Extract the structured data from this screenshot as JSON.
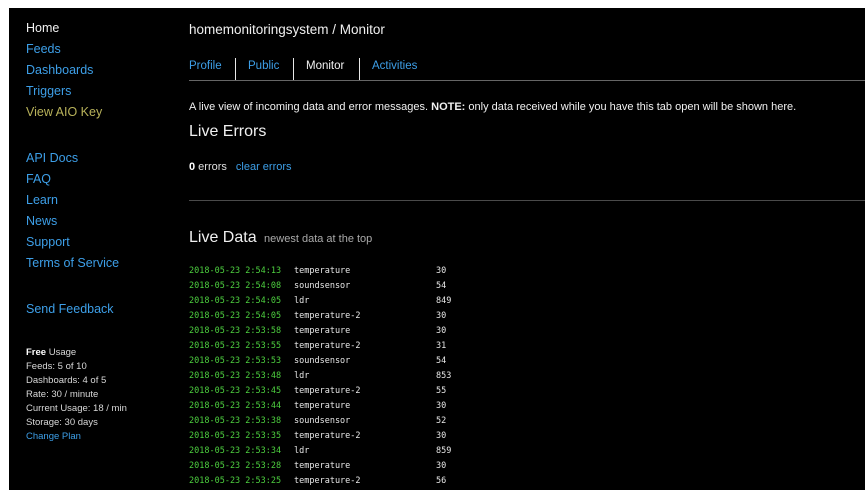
{
  "sidebar": {
    "nav_primary": [
      "Home",
      "Feeds",
      "Dashboards",
      "Triggers",
      "View AIO Key"
    ],
    "nav_secondary": [
      "API Docs",
      "FAQ",
      "Learn",
      "News",
      "Support",
      "Terms of Service"
    ],
    "send_feedback": "Send Feedback",
    "usage": {
      "title_bold": "Free",
      "title_rest": " Usage",
      "feeds": "Feeds: 5 of 10",
      "dashboards": "Dashboards: 4 of 5",
      "rate": "Rate: 30 / minute",
      "current": "Current Usage: 18 / min",
      "storage": "Storage: 30 days",
      "change_plan": "Change Plan"
    }
  },
  "header": {
    "breadcrumb": "homemonitoringsystem / Monitor"
  },
  "tabs": [
    "Profile",
    "Public",
    "Monitor",
    "Activities"
  ],
  "active_tab": "Monitor",
  "description": {
    "text": "A live view of incoming data and error messages. ",
    "note_label": "NOTE:",
    "note_text": " only data received while you have this tab open will be shown here."
  },
  "live_errors": {
    "heading": "Live Errors",
    "count": "0",
    "count_suffix": " errors",
    "clear_label": "clear errors"
  },
  "live_data": {
    "heading": "Live Data",
    "subheading": "newest data at the top",
    "rows": [
      {
        "timestamp": "2018-05-23 2:54:13",
        "feed": "temperature",
        "value": "30"
      },
      {
        "timestamp": "2018-05-23 2:54:08",
        "feed": "soundsensor",
        "value": "54"
      },
      {
        "timestamp": "2018-05-23 2:54:05",
        "feed": "ldr",
        "value": "849"
      },
      {
        "timestamp": "2018-05-23 2:54:05",
        "feed": "temperature-2",
        "value": "30"
      },
      {
        "timestamp": "2018-05-23 2:53:58",
        "feed": "temperature",
        "value": "30"
      },
      {
        "timestamp": "2018-05-23 2:53:55",
        "feed": "temperature-2",
        "value": "31"
      },
      {
        "timestamp": "2018-05-23 2:53:53",
        "feed": "soundsensor",
        "value": "54"
      },
      {
        "timestamp": "2018-05-23 2:53:48",
        "feed": "ldr",
        "value": "853"
      },
      {
        "timestamp": "2018-05-23 2:53:45",
        "feed": "temperature-2",
        "value": "55"
      },
      {
        "timestamp": "2018-05-23 2:53:44",
        "feed": "temperature",
        "value": "30"
      },
      {
        "timestamp": "2018-05-23 2:53:38",
        "feed": "soundsensor",
        "value": "52"
      },
      {
        "timestamp": "2018-05-23 2:53:35",
        "feed": "temperature-2",
        "value": "30"
      },
      {
        "timestamp": "2018-05-23 2:53:34",
        "feed": "ldr",
        "value": "859"
      },
      {
        "timestamp": "2018-05-23 2:53:28",
        "feed": "temperature",
        "value": "30"
      },
      {
        "timestamp": "2018-05-23 2:53:25",
        "feed": "temperature-2",
        "value": "56"
      }
    ]
  },
  "colors": {
    "background": "#000000",
    "link": "#3d9fe8",
    "timestamp": "#4dcf3f",
    "aio_key": "#b8b25a"
  }
}
